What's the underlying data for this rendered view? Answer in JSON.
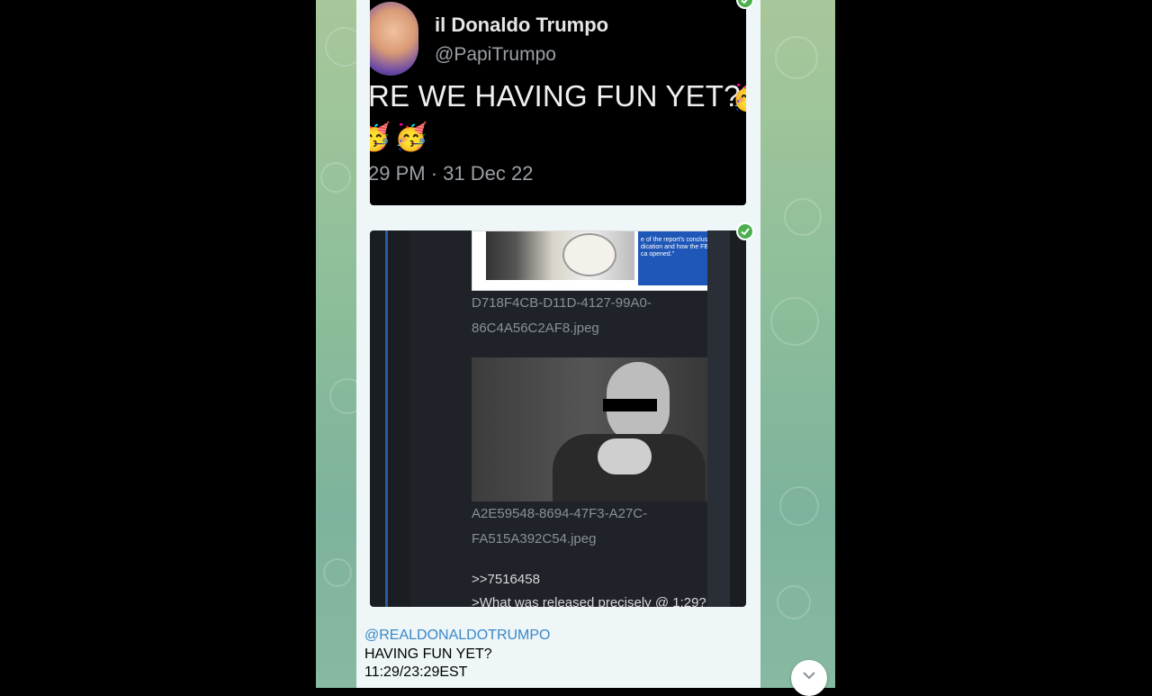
{
  "tweet": {
    "name": "il Donaldo Trumpo",
    "handle": "@PapiTrumpo",
    "text": "RE WE HAVING FUN YET??",
    "time": "29 PM · 31 Dec 22",
    "emoji_row": "🥳🥳",
    "emoji_inline": "🥳"
  },
  "thread": {
    "file1_line1": "D718F4CB-D11D-4127-99A0-",
    "file1_line2": "86C4A56C2AF8.jpeg",
    "file2_line1": "A2E59548-8694-47F3-A27C-",
    "file2_line2": "FA515A392C54.jpeg",
    "reply_ref": ">>7516458",
    "reply_text": ">What was released precisely @ 1:29?",
    "news_snippet": "e of the report's conclusion dication and how the FBI ca opened.\""
  },
  "message": {
    "mention": "@REALDONALDOTRUMPO",
    "line1": "HAVING FUN YET?",
    "line2": "11:29/23:29EST"
  },
  "icons": {
    "check": "check-circle-icon",
    "scroll_down": "chevron-down-icon"
  },
  "colors": {
    "check_green": "#4caf50",
    "link_blue": "#3a87c8",
    "bubble_bg": "#eef6f8"
  }
}
